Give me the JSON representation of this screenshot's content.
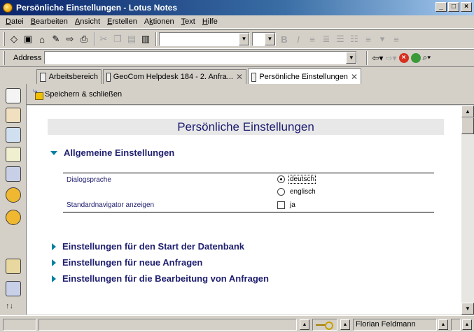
{
  "window": {
    "title": "Persönliche Einstellungen - Lotus Notes",
    "controls": [
      "_",
      "□",
      "×"
    ]
  },
  "menu": [
    {
      "accel": "D",
      "rest": "atei"
    },
    {
      "accel": "B",
      "rest": "earbeiten"
    },
    {
      "accel": "A",
      "rest": "nsicht"
    },
    {
      "accel": "E",
      "rest": "rstellen"
    },
    {
      "accel": "k",
      "pre": "A",
      "rest": "tionen"
    },
    {
      "accel": "T",
      "rest": "ext"
    },
    {
      "accel": "H",
      "rest": "ilfe"
    }
  ],
  "toolbar": {
    "font_combo_value": "",
    "size_combo_value": ""
  },
  "address": {
    "label": "Address",
    "value": ""
  },
  "tabs": [
    {
      "label": "Arbeitsbereich",
      "closable": false,
      "active": false
    },
    {
      "label": "GeoCom Helpdesk 184 - 2. Anfra...",
      "closable": true,
      "active": false
    },
    {
      "label": "Persönliche Einstellungen",
      "closable": true,
      "active": true
    }
  ],
  "action_bar": {
    "save_close_label": "Speichern & schließen"
  },
  "form": {
    "title": "Persönliche Einstellungen",
    "general_section": "Allgemeine Einstellungen",
    "dialog_language_label": "Dialogsprache",
    "language_options": [
      "deutsch",
      "englisch"
    ],
    "language_selected": "deutsch",
    "navigator_label": "Standardnavigator anzeigen",
    "navigator_option": "ja",
    "navigator_checked": false,
    "collapsed_sections": [
      "Einstellungen für den Start der Datenbank",
      "Einstellungen für neue Anfragen",
      "Einstellungen für die Bearbeitung von Anfragen"
    ]
  },
  "statusbar": {
    "user": "Florian Feldmann"
  },
  "colors": {
    "title_bar": "#0a246a",
    "section_text": "#202070",
    "twisty": "#0080a0"
  }
}
